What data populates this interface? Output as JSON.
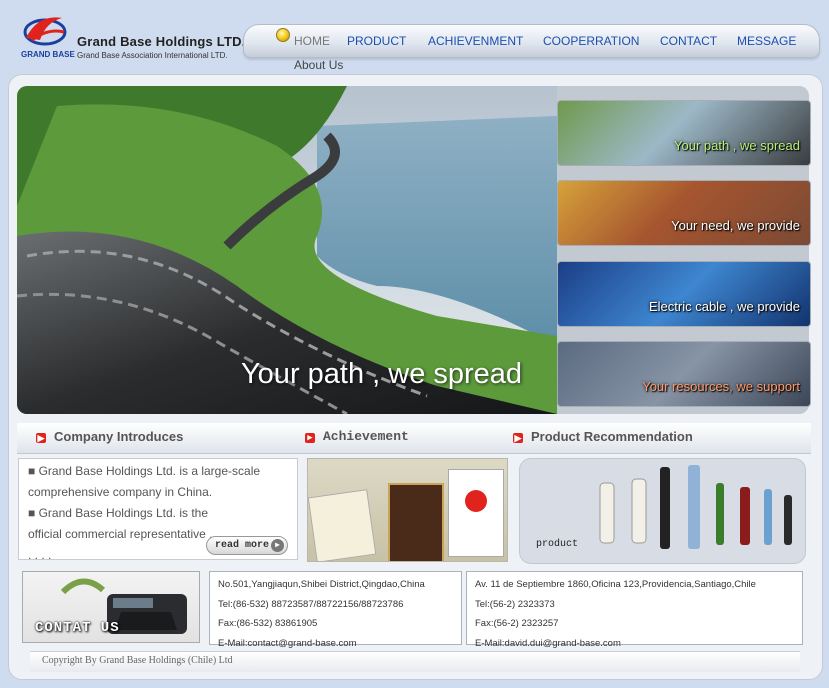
{
  "header": {
    "company_name": "Grand Base Holdings LTD.",
    "association": "Grand Base Association International LTD.",
    "logo_text": "GRAND BASE"
  },
  "nav": {
    "items": [
      {
        "label": "HOME"
      },
      {
        "label": "PRODUCT"
      },
      {
        "label": "ACHIEVENMENT"
      },
      {
        "label": "COOPERRATION"
      },
      {
        "label": "CONTACT"
      },
      {
        "label": "MESSAGE"
      }
    ],
    "submenu": "About Us"
  },
  "banner": {
    "headline": "Your path , we spread",
    "thumbs": [
      {
        "caption": "Your path , we spread"
      },
      {
        "caption": "Your need, we provide"
      },
      {
        "caption": "Electric cable , we provide"
      },
      {
        "caption": "Your resources, we support"
      }
    ]
  },
  "sections": {
    "company": "Company Introduces",
    "achievement": "Achievement",
    "product": "Product Recommendation"
  },
  "company": {
    "para1": "■ Grand Base Holdings Ltd. is a large-scale comprehensive company in China.",
    "para2": "■ Grand Base Holdings Ltd. is the official commercial representative . . . . . .",
    "read_more": "read more"
  },
  "product": {
    "label": "product"
  },
  "contact": {
    "image_label": "CONTAT US",
    "china": {
      "address": "No.501,Yangjiaqun,Shibei District,Qingdao,China",
      "tel": "Tel:(86-532) 88723587/88722156/88723786",
      "fax": "Fax:(86-532) 83861905",
      "email": "E-Mail:contact@grand-base.com"
    },
    "chile": {
      "address": "Av. 11 de Septiembre 1860,Oficina 123,Providencia,Santiago,Chile",
      "tel": "Tel:(56-2) 2323373",
      "fax": "Fax:(56-2) 2323257",
      "email": "E-Mail:david.dui@grand-base.com"
    }
  },
  "footer": {
    "copyright": "Copyright By Grand Base Holdings (Chile) Ltd"
  },
  "colors": {
    "nav_link": "#1a4fb0",
    "accent_red": "#e0231d",
    "page_bg": "#cfdcef"
  }
}
